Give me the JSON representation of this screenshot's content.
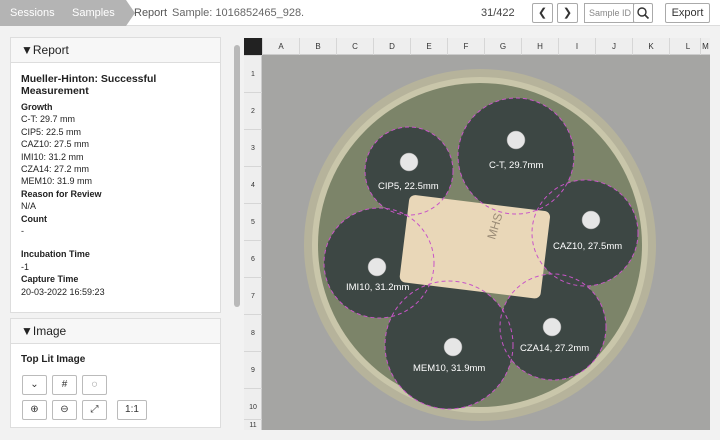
{
  "breadcrumb": {
    "sessions": "Sessions",
    "samples": "Samples",
    "report": "Report",
    "sample": "Sample: 1016852465_928."
  },
  "nav": {
    "counter": "31/422",
    "prev": "❮",
    "next": "❯",
    "sample_id_placeholder": "Sample ID",
    "export": "Export"
  },
  "report": {
    "header": "▼Report",
    "title": "Mueller-Hinton: Successful Measurement",
    "growth_label": "Growth",
    "growth": [
      "C-T: 29.7 mm",
      "CIP5: 22.5 mm",
      "CAZ10: 27.5 mm",
      "IMI10: 31.2 mm",
      "CZA14: 27.2 mm",
      "MEM10: 31.9 mm"
    ],
    "reason_label": "Reason for Review",
    "reason": "N/A",
    "count_label": "Count",
    "count": "-",
    "incubation_label": "Incubation Time",
    "incubation": "-1",
    "capture_label": "Capture Time",
    "capture": "20-03-2022 16:59:23"
  },
  "image_panel": {
    "header": "▼Image",
    "subtitle": "Top Lit Image",
    "tools": {
      "baseline": "⌄",
      "grid": "#",
      "circle": "◌",
      "zoom_in": "⊕",
      "zoom_out": "⊖",
      "fit": "⤢",
      "one_to_one": "1:1"
    }
  },
  "grid": {
    "columns": [
      "A",
      "B",
      "C",
      "D",
      "E",
      "F",
      "G",
      "H",
      "I",
      "J",
      "K",
      "L",
      "M"
    ],
    "rows": [
      "1",
      "2",
      "3",
      "4",
      "5",
      "6",
      "7",
      "8",
      "9",
      "10",
      "11"
    ]
  },
  "zones": {
    "ct": "C-T, 29.7mm",
    "cip5": "CIP5, 22.5mm",
    "caz10": "CAZ10, 27.5mm",
    "imi10": "IMI10, 31.2mm",
    "cza14": "CZA14, 27.2mm",
    "mem10": "MEM10, 31.9mm"
  },
  "colors": {
    "zone_ring": "#c855c8",
    "plate_edge": "#b8b59a",
    "agar": "#7c8469",
    "inhibition": "#3d4744"
  }
}
